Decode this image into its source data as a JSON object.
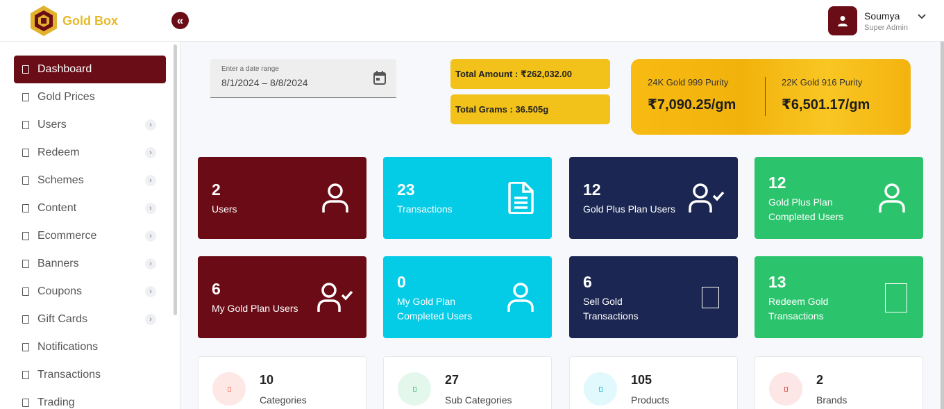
{
  "app": {
    "name": "Gold Box",
    "collapse_icon": "«"
  },
  "user": {
    "name": "Soumya",
    "role": "Super Admin"
  },
  "sidebar": {
    "items": [
      {
        "label": "Dashboard",
        "active": true,
        "has_children": false
      },
      {
        "label": "Gold Prices",
        "active": false,
        "has_children": false
      },
      {
        "label": "Users",
        "active": false,
        "has_children": true
      },
      {
        "label": "Redeem",
        "active": false,
        "has_children": true
      },
      {
        "label": "Schemes",
        "active": false,
        "has_children": true
      },
      {
        "label": "Content",
        "active": false,
        "has_children": true
      },
      {
        "label": "Ecommerce",
        "active": false,
        "has_children": true
      },
      {
        "label": "Banners",
        "active": false,
        "has_children": true
      },
      {
        "label": "Coupons",
        "active": false,
        "has_children": true
      },
      {
        "label": "Gift Cards",
        "active": false,
        "has_children": true
      },
      {
        "label": "Notifications",
        "active": false,
        "has_children": false
      },
      {
        "label": "Transactions",
        "active": false,
        "has_children": false
      },
      {
        "label": "Trading",
        "active": false,
        "has_children": false
      }
    ],
    "chevron_glyph": "›"
  },
  "date_range": {
    "label": "Enter a date range",
    "value": "8/1/2024 – 8/8/2024"
  },
  "totals": {
    "amount": "Total Amount : ₹262,032.00",
    "grams": "Total Grams : 36.505g"
  },
  "gold_prices": {
    "k24": {
      "title": "24K Gold 999 Purity",
      "value": "₹7,090.25/gm"
    },
    "k22": {
      "title": "22K Gold 916 Purity",
      "value": "₹6,501.17/gm"
    }
  },
  "stats": [
    {
      "value": "2",
      "label": "Users",
      "color": "#6a0b15",
      "icon": "user-icon"
    },
    {
      "value": "23",
      "label": "Transactions",
      "color": "#04cbe6",
      "icon": "document-icon"
    },
    {
      "value": "12",
      "label": "Gold Plus Plan Users",
      "color": "#1b2752",
      "icon": "user-check-icon"
    },
    {
      "value": "12",
      "label": "Gold Plus Plan Completed Users",
      "color": "#2bc46d",
      "icon": "user-icon"
    },
    {
      "value": "6",
      "label": "My Gold Plan Users",
      "color": "#6a0b15",
      "icon": "user-check-icon"
    },
    {
      "value": "0",
      "label": "My Gold Plan Completed Users",
      "color": "#04cbe6",
      "icon": "user-icon"
    },
    {
      "value": "6",
      "label": "Sell Gold Transactions",
      "color": "#1b2752",
      "icon": "placeholder-icon"
    },
    {
      "value": "13",
      "label": "Redeem Gold Transactions",
      "color": "#2bc46d",
      "icon": "placeholder-icon"
    }
  ],
  "mini_cards": [
    {
      "value": "10",
      "label": "Categories",
      "circle_color": "#fde8e6",
      "glyph_color": "#f08c7c"
    },
    {
      "value": "27",
      "label": "Sub Categories",
      "circle_color": "#e3f7ec",
      "glyph_color": "#5cc98a"
    },
    {
      "value": "105",
      "label": "Products",
      "circle_color": "#e1f8fc",
      "glyph_color": "#36c2dc"
    },
    {
      "value": "2",
      "label": "Brands",
      "circle_color": "#fde6e6",
      "glyph_color": "#e05a5a"
    }
  ]
}
